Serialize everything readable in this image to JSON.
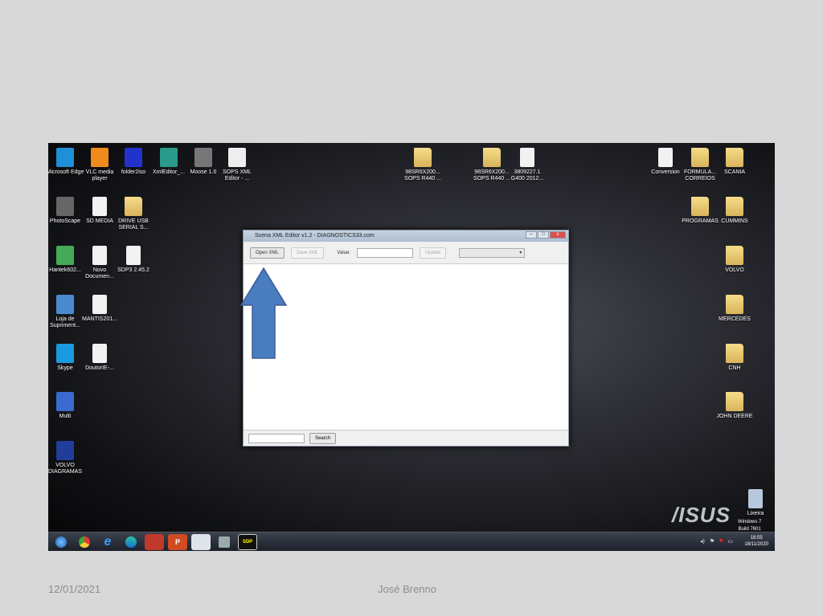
{
  "desktop": {
    "icons_left": [
      "Microsoft Edge",
      "VLC media player",
      "folder2iso",
      "XmlEditor_...",
      "Moose 1.0",
      "SOPS XML Editor - ...",
      "PhotoScape",
      "SD MEDIA",
      "DRIVE USB SERIAL S...",
      "Hantek602...",
      "Novo Documen...",
      "SDP3 2.45.2",
      "Loja de Supriment...",
      "MANTIS201...",
      "Skype",
      "DoutorIE-...",
      "Multi",
      "VOLVO DIAGRAMAS"
    ],
    "icons_middle": [
      "98SR6X200... SOPS R440 ...",
      "98SR6X200... SOPS R440 ...",
      "3809227.1 G400 2012..."
    ],
    "icons_right": [
      "Conversion",
      "FORMULA... CORREIOS",
      "SCANIA",
      "PROGRAMAS",
      "CUMMINS",
      "VOLVO",
      "MERCEDES",
      "CNH",
      "JOHN DEERE"
    ],
    "recycle_bin_label": "Lixeira",
    "brand": "/ISUS",
    "watermark": [
      "Windows 7",
      "Build 7601"
    ]
  },
  "window": {
    "title": "Scena XML Editor v1.2 - DIAGNOSTICS33.com",
    "open_xml": "Open XML",
    "save_xml": "Save XML",
    "value_label": "Value:",
    "value": "",
    "update": "Update",
    "select_value": "",
    "search_value": "",
    "search": "Search"
  },
  "taskbar": {
    "clock_time": "18:55",
    "clock_date": "18/11/2020"
  },
  "annotation": {
    "arrow_color": "#4a7cc0"
  },
  "footer": {
    "date": "12/01/2021",
    "author": "José Brenno"
  }
}
